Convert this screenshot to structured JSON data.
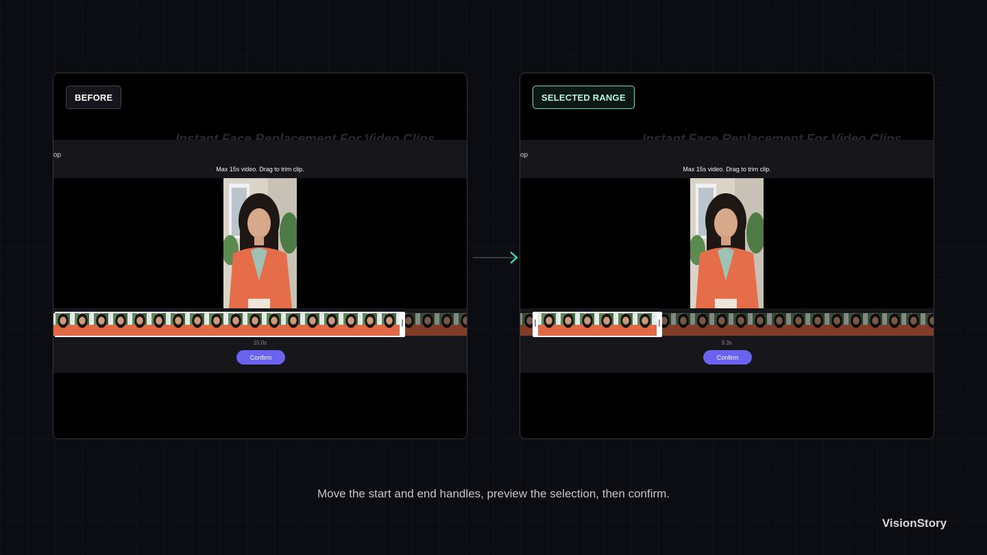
{
  "before_panel": {
    "tag": "BEFORE",
    "background_title": "Instant Face Replacement For Video Clips",
    "header_fragment": "op",
    "hint": "Max 15s video. Drag to trim clip.",
    "duration": "15.0s",
    "confirm_label": "Confirm",
    "selection": {
      "start": 0.0,
      "end": 1.0
    }
  },
  "after_panel": {
    "tag": "SELECTED RANGE",
    "background_title": "Instant Face Replacement For Video Clips",
    "header_fragment": "op",
    "hint": "Max 15s video. Drag to trim clip.",
    "duration": "5.3s",
    "confirm_label": "Confirm",
    "selection": {
      "start": 0.03,
      "end": 0.33
    }
  },
  "caption": "Move the start and end handles, preview the selection, then confirm.",
  "brand": "VisionStory",
  "colors": {
    "accent": "#6a63f0",
    "selected_tag_border": "#67e0c0",
    "arrow": "#3ed6a8",
    "background": "#0c0d12"
  },
  "icons": {
    "transition_arrow": "arrow-right-icon"
  }
}
